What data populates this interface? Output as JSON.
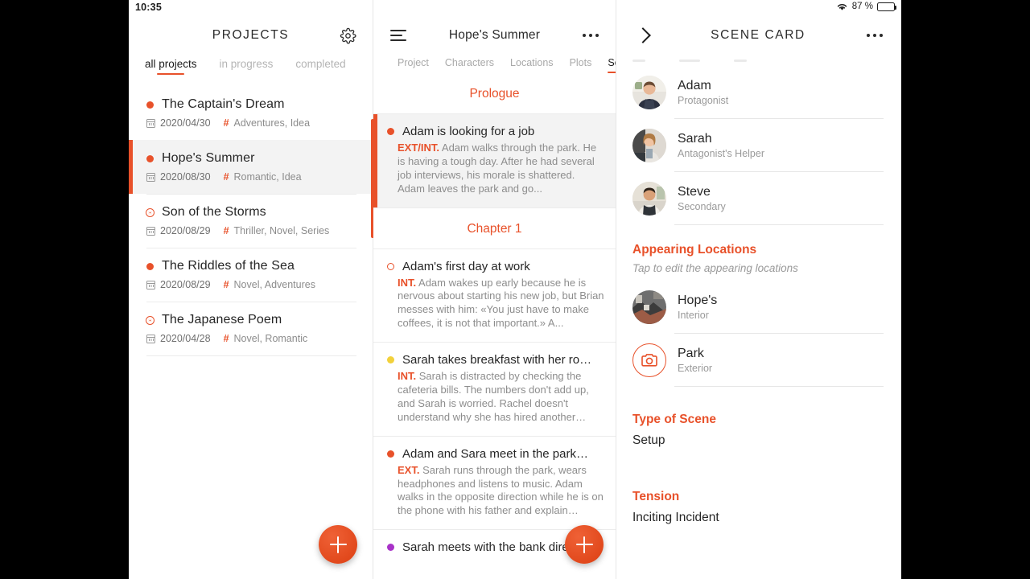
{
  "status_bar": {
    "time": "10:35",
    "wifi_icon": "wifi-icon",
    "battery_pct": "87 %"
  },
  "left_panel": {
    "title": "PROJECTS",
    "settings_icon": "gear-icon",
    "tabs": [
      {
        "label": "all projects",
        "active": true
      },
      {
        "label": "in progress",
        "active": false
      },
      {
        "label": "completed",
        "active": false
      }
    ],
    "projects": [
      {
        "name": "The Captain's Dream",
        "date": "2020/04/30",
        "tags": "Adventures, Idea",
        "marker": "filled",
        "selected": false
      },
      {
        "name": "Hope's Summer",
        "date": "2020/08/30",
        "tags": "Romantic, Idea",
        "marker": "filled",
        "selected": true
      },
      {
        "name": "Son of the Storms",
        "date": "2020/08/29",
        "tags": "Thriller, Novel, Series",
        "marker": "ring",
        "selected": false
      },
      {
        "name": "The Riddles of the Sea",
        "date": "2020/08/29",
        "tags": "Novel, Adventures",
        "marker": "filled",
        "selected": false
      },
      {
        "name": "The Japanese Poem",
        "date": "2020/04/28",
        "tags": "Novel, Romantic",
        "marker": "ring",
        "selected": false
      }
    ],
    "add_button": "add-project-button"
  },
  "middle_panel": {
    "title": "Hope's Summer",
    "menu_icon": "hamburger-icon",
    "more_icon": "more-options-icon",
    "tabs": [
      {
        "label": "Project",
        "active": false
      },
      {
        "label": "Characters",
        "active": false
      },
      {
        "label": "Locations",
        "active": false
      },
      {
        "label": "Plots",
        "active": false
      },
      {
        "label": "Sce",
        "active": true
      }
    ],
    "sections": [
      {
        "heading": "Prologue",
        "scenes": [
          {
            "title": "Adam is looking for a job",
            "tag": "EXT/INT.",
            "body": " Adam walks through the park. He is having a tough day. After he had several job interviews, his morale is shattered. Adam leaves the park and go...",
            "marker": "filled",
            "marker_color": "#e8512a",
            "selected": true
          }
        ]
      },
      {
        "heading": "Chapter 1",
        "scenes": [
          {
            "title": "Adam's first day at work",
            "tag": "INT.",
            "body": " Adam wakes up early because he is nervous about starting his new job, but Brian messes with him:  «You just have to make coffees, it is not that important.» A...",
            "marker": "ring",
            "marker_color": "#e8512a",
            "selected": false
          },
          {
            "title": "Sarah takes breakfast with her ro…",
            "tag": "INT.",
            "body": " Sarah is distracted by checking the cafeteria bills. The numbers don't add up, and Sarah is worried. Rachel doesn't understand why she has hired another…",
            "marker": "filled",
            "marker_color": "#f2d13b",
            "selected": false
          },
          {
            "title": "Adam and Sara meet in the park…",
            "tag": "EXT.",
            "body": " Sarah runs through the park, wears headphones and listens to music. Adam walks in the opposite direction while he is on the phone with his father and explain…",
            "marker": "filled",
            "marker_color": "#e8512a",
            "selected": false
          },
          {
            "title": "Sarah meets with the bank direct…",
            "tag": "",
            "body": "",
            "marker": "filled",
            "marker_color": "#a832c8",
            "selected": false
          }
        ]
      }
    ],
    "add_button": "add-scene-button"
  },
  "right_panel": {
    "title": "SCENE CARD",
    "back_icon": "chevron-right-icon",
    "more_icon": "more-options-icon",
    "characters": [
      {
        "name": "Adam",
        "role": "Protagonist",
        "avatar": "photo-avatar"
      },
      {
        "name": "Sarah",
        "role": "Antagonist's Helper",
        "avatar": "photo-avatar"
      },
      {
        "name": "Steve",
        "role": "Secondary",
        "avatar": "photo-avatar"
      }
    ],
    "locations_section": {
      "title": "Appearing Locations",
      "hint": "Tap to edit the appearing locations",
      "items": [
        {
          "name": "Hope's",
          "kind": "Interior",
          "avatar": "photo-avatar"
        },
        {
          "name": "Park",
          "kind": "Exterior",
          "avatar": "camera-icon"
        }
      ]
    },
    "type_section": {
      "title": "Type of Scene",
      "value": "Setup"
    },
    "tension_section": {
      "title": "Tension",
      "value": "Inciting Incident"
    }
  },
  "theme": {
    "accent": "#e8512a",
    "text": "#262626",
    "muted": "#8d8d8d"
  }
}
